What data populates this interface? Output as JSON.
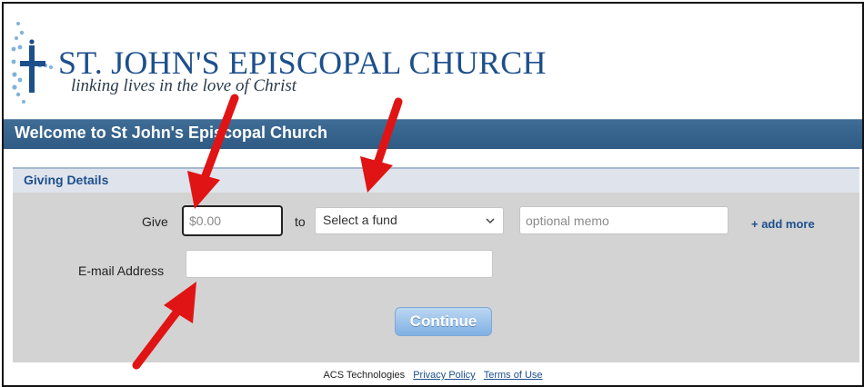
{
  "header": {
    "church_name": "ST. JOHN'S EPISCOPAL CHURCH",
    "tagline": "linking lives in the love of Christ",
    "welcome": "Welcome to St John's Episcopal Church"
  },
  "giving": {
    "title": "Giving Details",
    "give_label": "Give",
    "amount_placeholder": "$0.00",
    "to_label": "to",
    "fund_selected": "Select a fund",
    "memo_placeholder": "optional memo",
    "add_more": "+ add more",
    "email_label": "E-mail Address",
    "email_value": "",
    "continue_label": "Continue"
  },
  "footer": {
    "company": "ACS Technologies",
    "privacy": "Privacy Policy",
    "terms": "Terms of Use"
  },
  "colors": {
    "brand_blue": "#1d4f8c",
    "bar_blue": "#2e5a83",
    "panel_gray": "#d3d3d3",
    "arrow_red": "#e01414"
  }
}
